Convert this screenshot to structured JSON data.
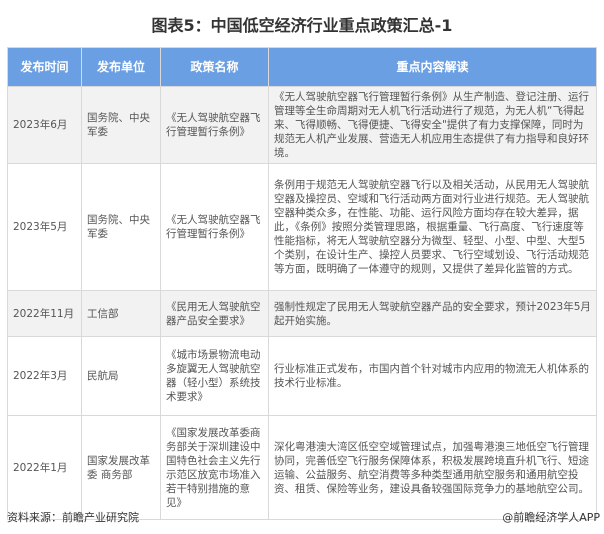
{
  "title": "图表5：中国低空经济行业重点政策汇总-1",
  "headers": [
    "发布时间",
    "发布单位",
    "政策名称",
    "重点内容解读"
  ],
  "rows": [
    {
      "date": "2023年6月",
      "issuer": "国务院、中央军委",
      "name": "《无人驾驶航空器飞行管理暂行条例》",
      "content": "《无人驾驶航空器飞行管理暂行条例》从生产制造、登记注册、运行管理等全生命周期对无人机飞行活动进行了规范，为无人机“飞得起来、飞得顺畅、飞得便捷、飞得安全\"提供了有力支撑保障，同时为规范无人机产业发展、营造无人机应用生态提供了有力指导和良好环境。"
    },
    {
      "date": "2023年5月",
      "issuer": "国务院、中央军委",
      "name": "《无人驾驶航空器飞行管理暂行条例》",
      "content": "条例用于规范无人驾驶航空器飞行以及相关活动，从民用无人驾驶航空器及操控员、空域和飞行活动两方面对行业进行规范。无人驾驶航空器种类众多，在性能、功能、运行风险方面均存在较大差异，据此，《条例》按照分类管理思路，根据重量、飞行高度、飞行速度等性能指标，将无人驾驶航空器分为微型、轻型、小型、中型、大型5个类别，在设计生产、操控人员要求、飞行空域划设、飞行活动规范等方面，既明确了一体遵守的规则，又提供了差异化监管的方式。"
    },
    {
      "date": "2022年11月",
      "issuer": "工信部",
      "name": "《民用无人驾驶航空器产品安全要求》",
      "content": "强制性规定了民用无人驾驶航空器产品的安全要求，预计2023年5月起开始实施。"
    },
    {
      "date": "2022年3月",
      "issuer": "民航局",
      "name": "《城市场景物流电动多旋翼无人驾驶航空器（轻小型）系统技术要求》",
      "content": "行业标准正式发布，市国内首个针对城市内应用的物流无人机体系的技术行业标准。"
    },
    {
      "date": "2022年1月",
      "issuer": "国家发展改革委 商务部",
      "name": "《国家发展改革委商务部关于深圳建设中国特色社会主义先行示范区放宽市场准入若干特别措施的意见》",
      "content": "深化粤港澳大湾区低空空域管理试点，加强粤港澳三地低空飞行管理协同，完善低空飞行服务保障体系，积极发展跨境直升机飞行、短途运输、公益服务、航空消费等多种类型通用航空服务和通用航空投资、租赁、保险等业务，建设具备较强国际竞争力的基地航空公司。"
    }
  ],
  "source": "资料来源：前瞻产业研究院",
  "credit": "@前瞻经济学人APP"
}
